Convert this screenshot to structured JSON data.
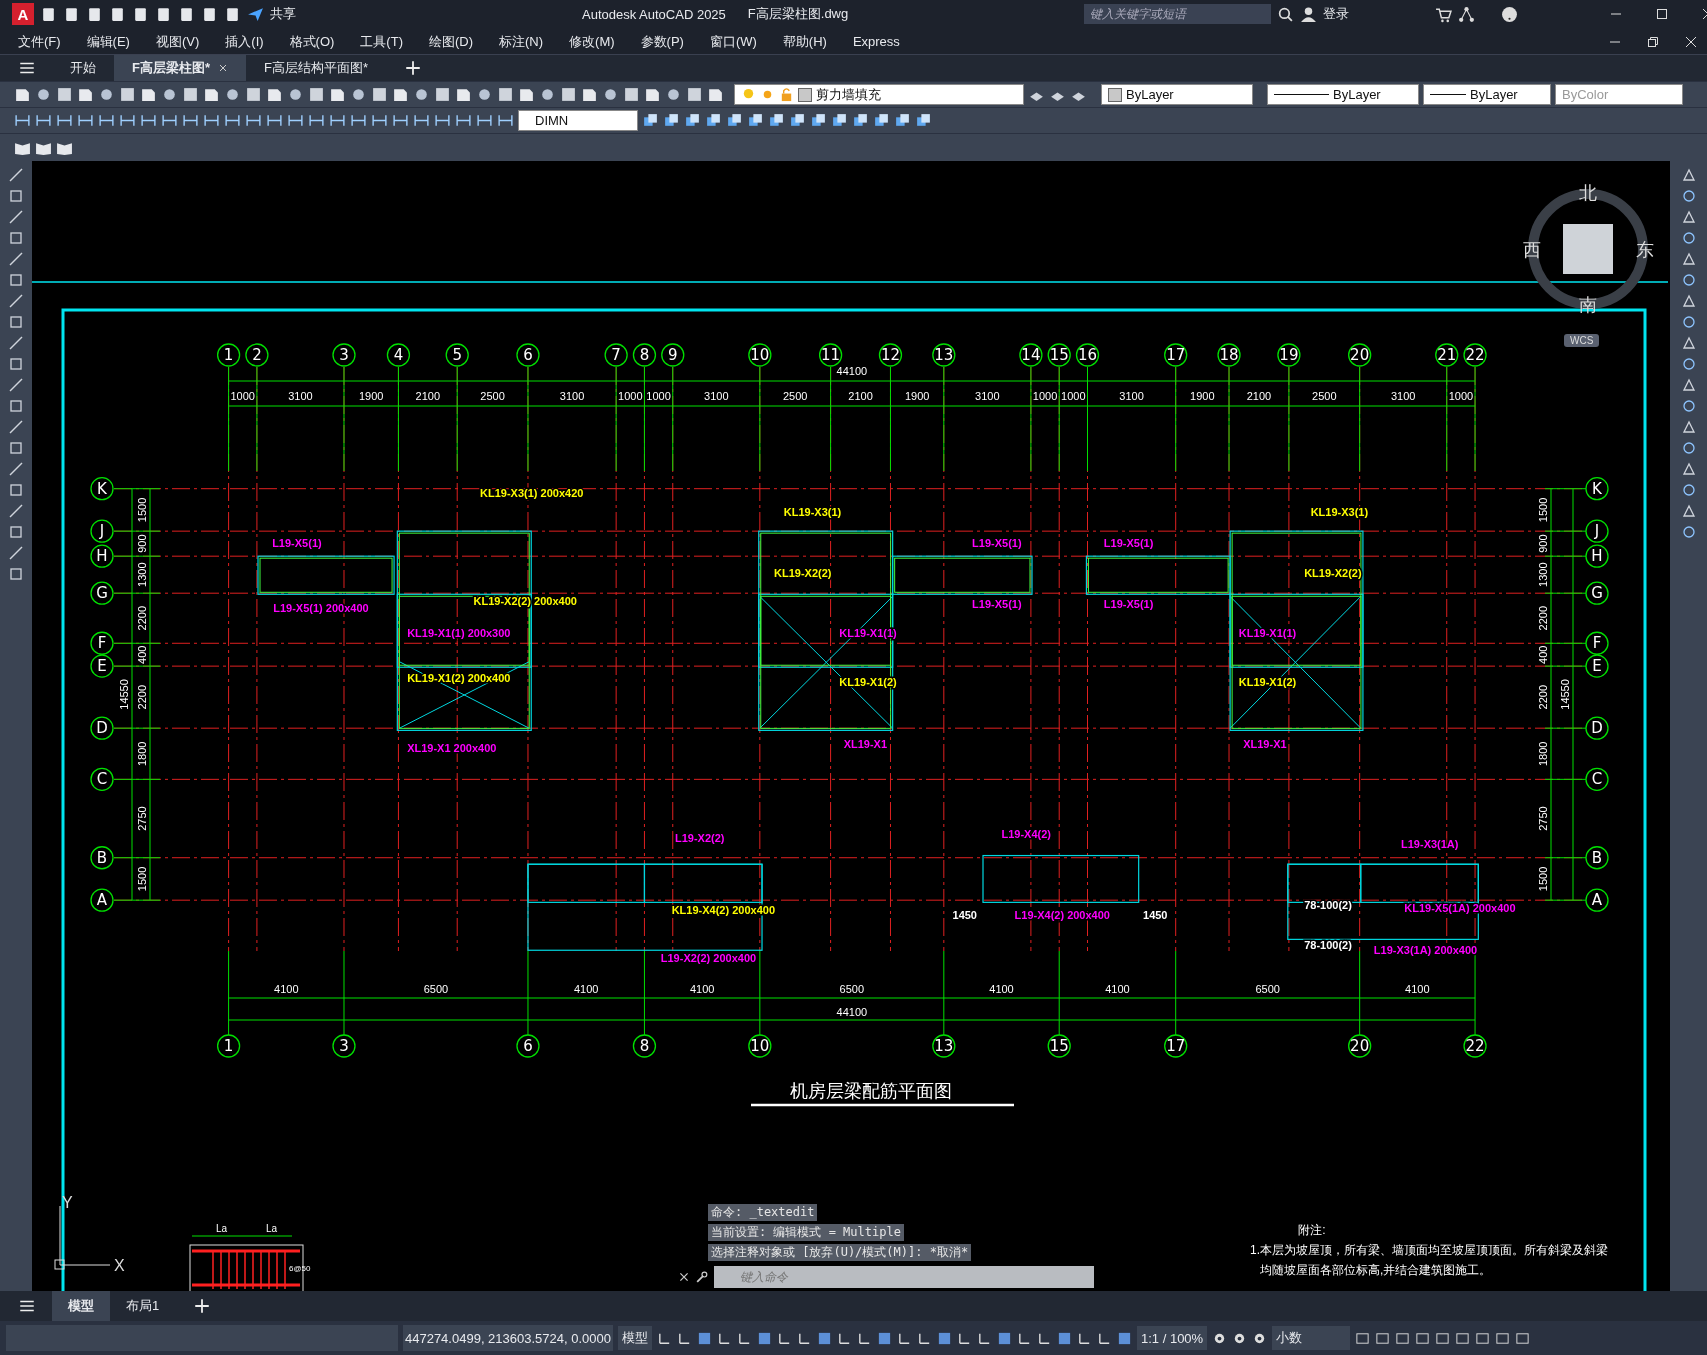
{
  "title_bar": {
    "logo": "A",
    "share": "共享",
    "app": "Autodesk AutoCAD 2025",
    "file": "F高层梁柱图.dwg",
    "search": {
      "placeholder": "键入关键字或短语"
    },
    "login": "登录"
  },
  "menu": [
    "文件(F)",
    "编辑(E)",
    "视图(V)",
    "插入(I)",
    "格式(O)",
    "工具(T)",
    "绘图(D)",
    "标注(N)",
    "修改(M)",
    "参数(P)",
    "窗口(W)",
    "帮助(H)",
    "Express"
  ],
  "file_tabs": [
    {
      "label": "开始",
      "selected": false
    },
    {
      "label": "F高层梁柱图*",
      "selected": true
    },
    {
      "label": "F高层结构平面图*",
      "selected": false
    }
  ],
  "toolbar": {
    "layer": "剪力墙填充",
    "color_setting": "ByLayer",
    "linetype": "ByLayer",
    "lineweight": "ByLayer",
    "plot_style": {
      "label": "ByColor",
      "disabled": true
    },
    "dim_style": "DIMN"
  },
  "viewcube": {
    "north": "北",
    "south": "南",
    "east": "东",
    "west": "西",
    "ucs": "WCS"
  },
  "drawing": {
    "top_axes": [
      "1",
      "2",
      "3",
      "4",
      "5",
      "6",
      "7",
      "8",
      "9",
      "10",
      "11",
      "12",
      "13",
      "14",
      "15",
      "16",
      "17",
      "18",
      "19",
      "20",
      "21",
      "22"
    ],
    "top_total": "44100",
    "top_dims": [
      "1000",
      "3100",
      "1900",
      "2100",
      "2500",
      "3100",
      "1000",
      "1000",
      "3100",
      "2500",
      "2100",
      "1900",
      "3100",
      "1000",
      "1000",
      "3100",
      "1900",
      "2100",
      "2500",
      "3100",
      "1000"
    ],
    "bottom_dims": [
      "4100",
      "6500",
      "4100",
      "4100",
      "6500",
      "4100",
      "4100",
      "6500",
      "4100"
    ],
    "bottom_total": "44100",
    "bottom_axes": [
      "1",
      "3",
      "6",
      "8",
      "10",
      "13",
      "15",
      "17",
      "20",
      "22"
    ],
    "left_axes": [
      "K",
      "J",
      "H",
      "G",
      "F",
      "E",
      "D",
      "C",
      "B",
      "A"
    ],
    "right_axes": [
      "K",
      "J",
      "H",
      "G",
      "F",
      "E",
      "D",
      "C",
      "B",
      "A"
    ],
    "left_dims": [
      "1500",
      "900",
      "1300",
      "2200",
      "400",
      "2200",
      "1800",
      "2750",
      "1500"
    ],
    "left_total": "14550",
    "right_dims": [
      "1500",
      "900",
      "1300",
      "2200",
      "400",
      "2200",
      "1800",
      "2750",
      "1500"
    ],
    "right_total": "14550",
    "beam_labels": [
      {
        "text": "KL19-X3(1) 200x420",
        "color": "#ffff00"
      },
      {
        "text": "L19-X5(1)",
        "color": "#ff00ff"
      },
      {
        "text": "L19-X5(1) 200x400",
        "color": "#ff00ff"
      },
      {
        "text": "KL19-X2(2) 200x400",
        "color": "#ffff00"
      },
      {
        "text": "KL19-X1(1) 200x300",
        "color": "#ff00ff"
      },
      {
        "text": "KL19-X1(2) 200x400",
        "color": "#ffff00"
      },
      {
        "text": "XL19-X1 200x400",
        "color": "#ff00ff"
      },
      {
        "text": "KL19-X3(1)",
        "color": "#ffff00"
      },
      {
        "text": "KL19-X2(2)",
        "color": "#ffff00"
      },
      {
        "text": "L19-X5(1)",
        "color": "#ff00ff"
      },
      {
        "text": "L19-X5(1)",
        "color": "#ff00ff"
      },
      {
        "text": "KL19-X1(1)",
        "color": "#ff00ff"
      },
      {
        "text": "KL19-X1(2)",
        "color": "#ffff00"
      },
      {
        "text": "XL19-X1",
        "color": "#ff00ff"
      },
      {
        "text": "L19-X5(1)",
        "color": "#ff00ff"
      },
      {
        "text": "L19-X5(1)",
        "color": "#ff00ff"
      },
      {
        "text": "KL19-X3(1)",
        "color": "#ffff00"
      },
      {
        "text": "KL19-X2(2)",
        "color": "#ffff00"
      },
      {
        "text": "KL19-X1(1)",
        "color": "#ff00ff"
      },
      {
        "text": "KL19-X1(2)",
        "color": "#ffff00"
      },
      {
        "text": "XL19-X1",
        "color": "#ff00ff"
      },
      {
        "text": "L19-X2(2)",
        "color": "#ff00ff"
      },
      {
        "text": "KL19-X4(2) 200x400",
        "color": "#ffff00"
      },
      {
        "text": "L19-X2(2) 200x400",
        "color": "#ff00ff"
      },
      {
        "text": "L19-X4(2)",
        "color": "#ff00ff"
      },
      {
        "text": "L19-X4(2) 200x400",
        "color": "#ff00ff"
      },
      {
        "text": "L19-X3(1A)",
        "color": "#ff00ff"
      },
      {
        "text": "KL19-X5(1A) 200x400",
        "color": "#ff00ff"
      },
      {
        "text": "L19-X3(1A) 200x400",
        "color": "#ff00ff"
      },
      {
        "text": "78-100(2)",
        "color": "#ffffff"
      },
      {
        "text": "78-100(2)",
        "color": "#ffffff"
      },
      {
        "text": "1450",
        "color": "#ffffff"
      },
      {
        "text": "1450",
        "color": "#ffffff"
      }
    ],
    "title": "机房层梁配筋平面图",
    "notes": {
      "heading": "附注:",
      "lines": [
        "1.本层为坡屋顶，所有梁、墙顶面均至坡屋顶顶面。所有斜梁及斜梁",
        "均随坡屋面各部位标高,并结合建筑图施工。"
      ]
    },
    "detail": {
      "labels": [
        "La",
        "La"
      ],
      "spec": "6@50"
    },
    "ucs": {
      "x": "X",
      "y": "Y"
    }
  },
  "command_line": {
    "history": [
      "命令: _textedit",
      "当前设置: 编辑模式 = Multiple",
      "选择注释对象或 [放弃(U)/模式(M)]: *取消*"
    ],
    "placeholder": "键入命令"
  },
  "layout_tabs": [
    {
      "label": "模型",
      "selected": true
    },
    {
      "label": "布局1",
      "selected": false
    }
  ],
  "status_bar": {
    "coordinates": "447274.0499, 213603.5724, 0.0000",
    "space": "模型",
    "scale": "1:1 / 100%",
    "units": "小数"
  }
}
